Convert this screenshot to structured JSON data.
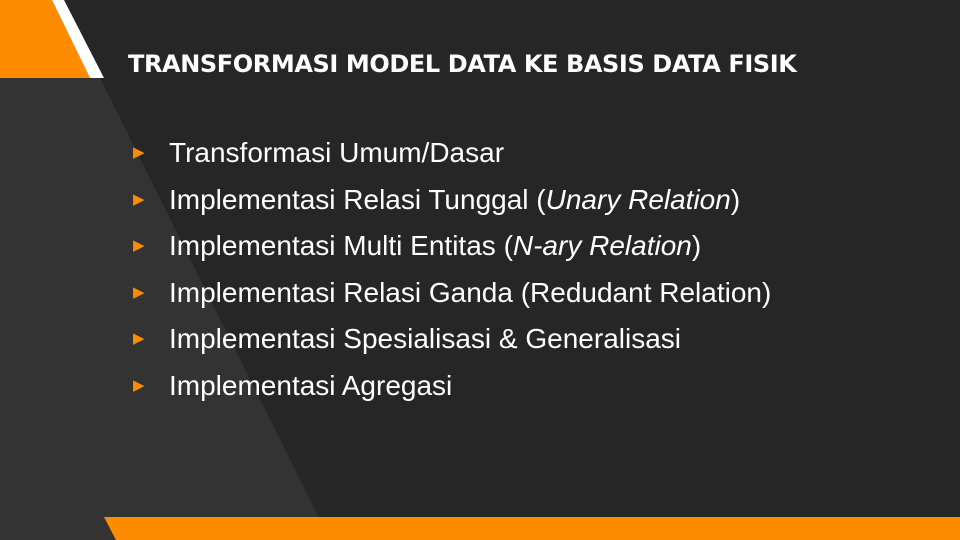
{
  "colors": {
    "background": "#262626",
    "background_band": "#333333",
    "accent": "#ff8c00",
    "text": "#ffffff"
  },
  "slide": {
    "title": "TRANSFORMASI MODEL DATA KE BASIS DATA FISIK",
    "bullet_icon": "triangle-right-icon",
    "bullets": [
      {
        "before": "Transformasi Umum/Dasar",
        "italic": "",
        "after": ""
      },
      {
        "before": "Implementasi Relasi Tunggal (",
        "italic": "Unary Relation",
        "after": ")"
      },
      {
        "before": "Implementasi Multi Entitas (",
        "italic": "N-ary Relation",
        "after": ")"
      },
      {
        "before": "Implementasi Relasi Ganda (Redudant Relation)",
        "italic": "",
        "after": ""
      },
      {
        "before": "Implementasi Spesialisasi & Generalisasi",
        "italic": "",
        "after": ""
      },
      {
        "before": "Implementasi Agregasi",
        "italic": "",
        "after": ""
      }
    ]
  }
}
